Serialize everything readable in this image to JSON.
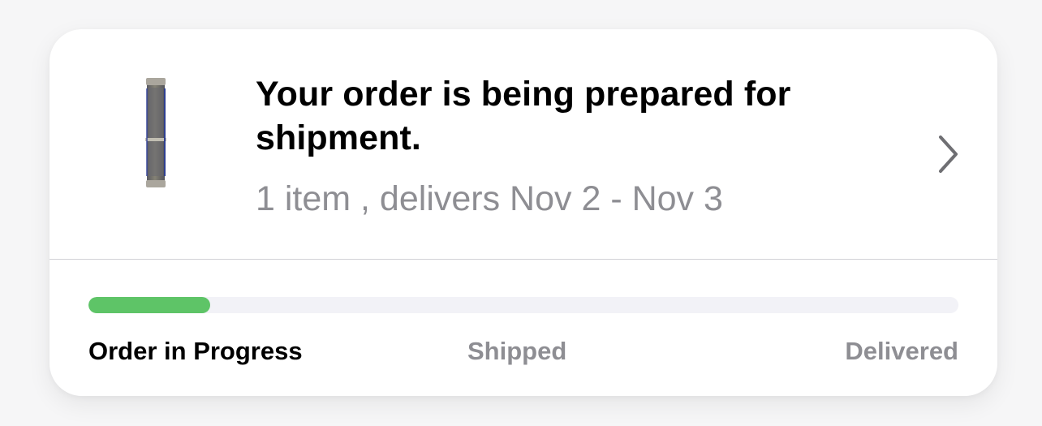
{
  "order": {
    "title": "Your order is being prepared for shipment.",
    "summary": "1 item , delivers Nov 2 - Nov 3",
    "product_image": "watch-band-thumbnail",
    "chevron_icon": "chevron-right-icon"
  },
  "progress": {
    "fraction": 0.14,
    "fill_color": "#5ec467",
    "track_color": "#f2f2f7",
    "stages": [
      {
        "label": "Order in Progress",
        "state": "active"
      },
      {
        "label": "Shipped",
        "state": "pending"
      },
      {
        "label": "Delivered",
        "state": "pending"
      }
    ]
  },
  "colors": {
    "active_text": "#000000",
    "inactive_text": "#8e8e93",
    "card_background": "#ffffff",
    "page_background": "#f6f6f7"
  }
}
